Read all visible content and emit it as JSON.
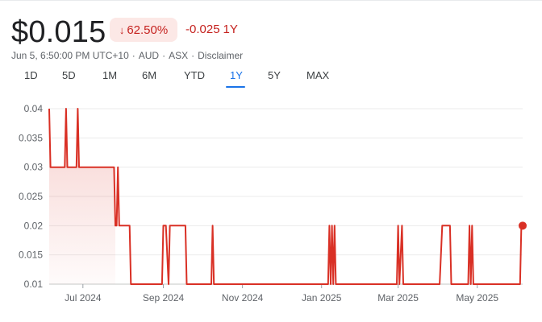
{
  "quote": {
    "price": "$0.015",
    "change_percent": "62.50%",
    "change_percent_direction_icon": "arrow-down-icon",
    "change_abs": "-0.025",
    "change_period": "1Y",
    "negative_color": "#c5221f",
    "negative_bg": "#fce8e6"
  },
  "meta": {
    "timestamp": "Jun 5, 6:50:00 PM UTC+10",
    "currency": "AUD",
    "exchange": "ASX",
    "disclaimer": "Disclaimer"
  },
  "tabs": [
    {
      "label": "1D",
      "active": false
    },
    {
      "label": "5D",
      "active": false
    },
    {
      "label": "1M",
      "active": false
    },
    {
      "label": "6M",
      "active": false
    },
    {
      "label": "YTD",
      "active": false
    },
    {
      "label": "1Y",
      "active": true
    },
    {
      "label": "5Y",
      "active": false
    },
    {
      "label": "MAX",
      "active": false
    }
  ],
  "chart_data": {
    "type": "line",
    "title": "",
    "xlabel": "",
    "ylabel": "",
    "ylim": [
      0.01,
      0.04
    ],
    "y_ticks": [
      "0.04",
      "0.035",
      "0.03",
      "0.025",
      "0.02",
      "0.015",
      "0.01"
    ],
    "x_ticks": [
      {
        "date": "2024-07-01",
        "label": "Jul 2024"
      },
      {
        "date": "2024-09-01",
        "label": "Sep 2024"
      },
      {
        "date": "2024-11-01",
        "label": "Nov 2024"
      },
      {
        "date": "2025-01-01",
        "label": "Jan 2025"
      },
      {
        "date": "2025-03-01",
        "label": "Mar 2025"
      },
      {
        "date": "2025-05-01",
        "label": "May 2025"
      }
    ],
    "grid": true,
    "line_color": "#d93025",
    "fill_until": "2024-07-26",
    "series": [
      {
        "points": [
          [
            "2024-06-05",
            0.04
          ],
          [
            "2024-06-06",
            0.03
          ],
          [
            "2024-06-17",
            0.03
          ],
          [
            "2024-06-18",
            0.04
          ],
          [
            "2024-06-19",
            0.03
          ],
          [
            "2024-06-26",
            0.03
          ],
          [
            "2024-06-27",
            0.04
          ],
          [
            "2024-06-28",
            0.03
          ],
          [
            "2024-07-25",
            0.03
          ],
          [
            "2024-07-26",
            0.02
          ],
          [
            "2024-07-27",
            0.02
          ],
          [
            "2024-07-28",
            0.03
          ],
          [
            "2024-07-29",
            0.02
          ],
          [
            "2024-08-06",
            0.02
          ],
          [
            "2024-08-07",
            0.01
          ],
          [
            "2024-08-31",
            0.01
          ],
          [
            "2024-09-01",
            0.02
          ],
          [
            "2024-09-03",
            0.02
          ],
          [
            "2024-09-05",
            0.01
          ],
          [
            "2024-09-06",
            0.02
          ],
          [
            "2024-09-18",
            0.02
          ],
          [
            "2024-09-19",
            0.01
          ],
          [
            "2024-10-08",
            0.01
          ],
          [
            "2024-10-09",
            0.02
          ],
          [
            "2024-10-10",
            0.01
          ],
          [
            "2025-01-06",
            0.01
          ],
          [
            "2025-01-07",
            0.02
          ],
          [
            "2025-01-08",
            0.01
          ],
          [
            "2025-01-09",
            0.02
          ],
          [
            "2025-01-10",
            0.01
          ],
          [
            "2025-01-11",
            0.02
          ],
          [
            "2025-01-12",
            0.01
          ],
          [
            "2025-02-28",
            0.01
          ],
          [
            "2025-03-01",
            0.02
          ],
          [
            "2025-03-02",
            0.01
          ],
          [
            "2025-03-04",
            0.02
          ],
          [
            "2025-03-05",
            0.01
          ],
          [
            "2025-04-02",
            0.01
          ],
          [
            "2025-04-04",
            0.02
          ],
          [
            "2025-04-10",
            0.02
          ],
          [
            "2025-04-11",
            0.01
          ],
          [
            "2025-04-24",
            0.01
          ],
          [
            "2025-04-25",
            0.02
          ],
          [
            "2025-04-26",
            0.01
          ],
          [
            "2025-04-27",
            0.02
          ],
          [
            "2025-04-28",
            0.01
          ],
          [
            "2025-06-03",
            0.01
          ],
          [
            "2025-06-04",
            0.02
          ],
          [
            "2025-06-05",
            0.02
          ]
        ]
      }
    ]
  }
}
